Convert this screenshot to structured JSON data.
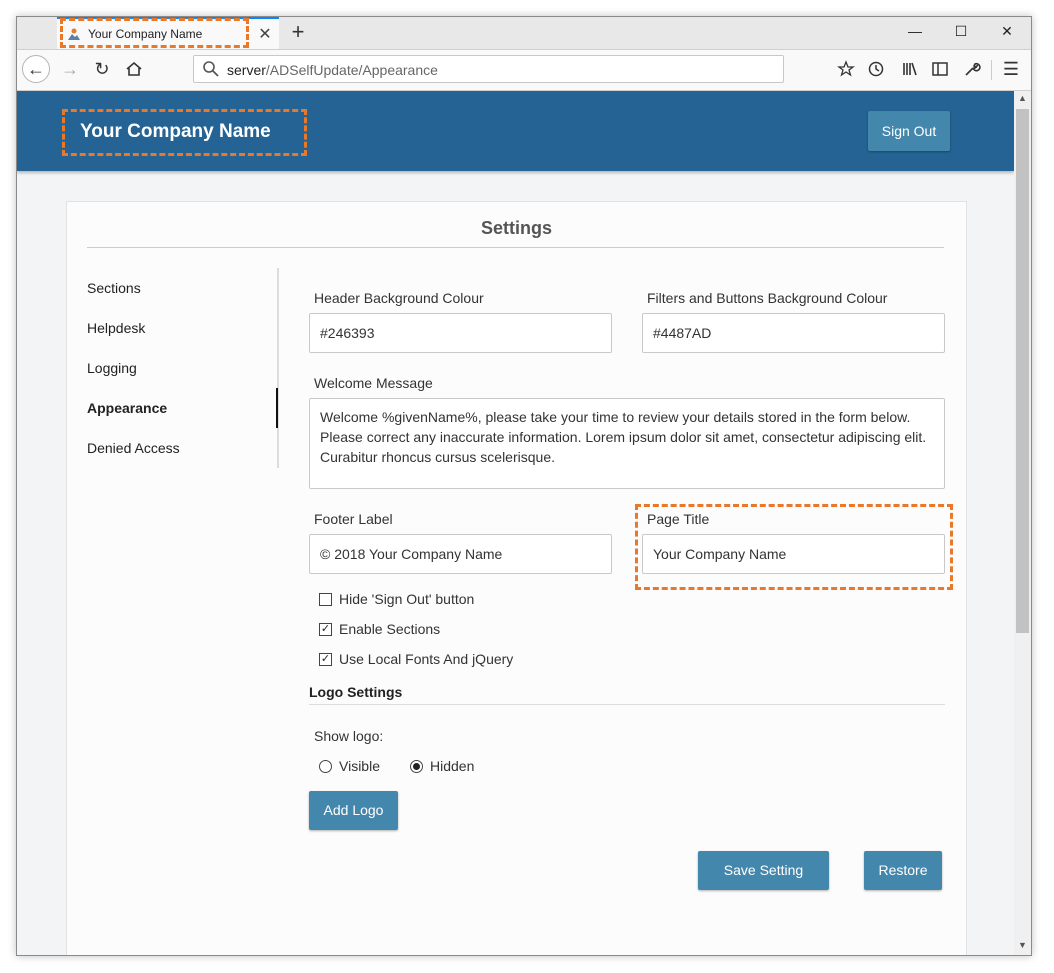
{
  "browser": {
    "tab_title": "Your Company Name",
    "url_host": "server",
    "url_path": "/ADSelfUpdate/Appearance"
  },
  "colors": {
    "header_bg": "#246393",
    "button_bg": "#4487AD",
    "highlight": "#e8782a"
  },
  "header": {
    "company_name": "Your Company Name",
    "signout_label": "Sign Out"
  },
  "settings": {
    "title": "Settings",
    "sidebar": [
      {
        "label": "Sections"
      },
      {
        "label": "Helpdesk"
      },
      {
        "label": "Logging"
      },
      {
        "label": "Appearance",
        "active": true
      },
      {
        "label": "Denied Access"
      }
    ],
    "fields": {
      "header_bg_label": "Header Background Colour",
      "header_bg_value": "#246393",
      "filters_bg_label": "Filters and Buttons Background Colour",
      "filters_bg_value": "#4487AD",
      "welcome_label": "Welcome Message",
      "welcome_value": "Welcome %givenName%, please take your time to review your details stored in the form below. Please correct any inaccurate information. Lorem ipsum dolor sit amet, consectetur adipiscing elit. Curabitur rhoncus cursus scelerisque.",
      "footer_label": "Footer Label",
      "footer_value": "© 2018 Your Company Name",
      "page_title_label": "Page Title",
      "page_title_value": "Your Company Name"
    },
    "checkboxes": [
      {
        "label": "Hide 'Sign Out' button",
        "checked": false
      },
      {
        "label": "Enable Sections",
        "checked": true
      },
      {
        "label": "Use Local Fonts And jQuery",
        "checked": true
      }
    ],
    "logo": {
      "section_title": "Logo Settings",
      "show_logo_label": "Show logo:",
      "visible_label": "Visible",
      "hidden_label": "Hidden",
      "selected": "Hidden",
      "add_logo_label": "Add Logo"
    },
    "save_label": "Save Setting",
    "restore_label": "Restore"
  }
}
